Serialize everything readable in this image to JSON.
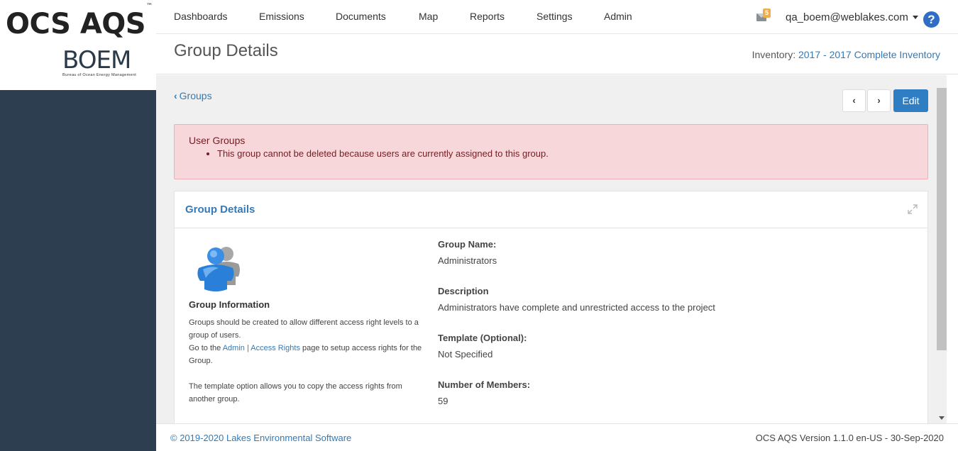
{
  "app": {
    "logo_text": "OCS AQS",
    "logo_tm": "™",
    "agency_logo_text": "BOEM",
    "agency_logo_subtitle": "Bureau of Ocean Energy Management"
  },
  "nav": {
    "items": [
      {
        "label": "Dashboards"
      },
      {
        "label": "Emissions"
      },
      {
        "label": "Documents"
      },
      {
        "label": "Map"
      },
      {
        "label": "Reports"
      },
      {
        "label": "Settings"
      },
      {
        "label": "Admin"
      }
    ],
    "mail_badge": "5",
    "mail_icon": "envelope-icon",
    "user": "qa_boem@weblakes.com",
    "help_icon": "question-circle-icon",
    "help_glyph": "?"
  },
  "header": {
    "title": "Group Details",
    "inventory_label": "Inventory:",
    "inventory_value": "2017 - 2017 Complete Inventory"
  },
  "toolbar": {
    "back_label": "Groups",
    "prev_glyph": "‹",
    "next_glyph": "›",
    "edit_label": "Edit"
  },
  "alert": {
    "title": "User Groups",
    "messages": [
      "This group cannot be deleted because users are currently assigned to this group."
    ]
  },
  "panel": {
    "title": "Group Details",
    "info_title": "Group Information",
    "info_text_1a": "Groups should be created to allow different access right levels to a group of users.",
    "info_text_1b_pre": "Go to the ",
    "info_link_admin": "Admin",
    "info_sep": " | ",
    "info_link_rights": "Access Rights",
    "info_text_1b_post": " page to setup access rights for the Group.",
    "info_text_2": "The template option allows you to copy the access rights from another group.",
    "fields": [
      {
        "label": "Group Name:",
        "value": "Administrators"
      },
      {
        "label": "Description",
        "value": "Administrators have complete and unrestricted access to the project"
      },
      {
        "label": "Template (Optional):",
        "value": "Not Specified"
      },
      {
        "label": "Number of Members:",
        "value": "59"
      }
    ]
  },
  "footer": {
    "copyright": "© 2019-2020 Lakes Environmental Software",
    "version": "OCS AQS Version 1.1.0 en-US - 30-Sep-2020"
  },
  "colors": {
    "sidebar": "#2c3e50",
    "link": "#337ab7",
    "primary_button": "#2f7dc3",
    "alert_bg": "#f8d7da",
    "badge": "#f0ad4e"
  }
}
